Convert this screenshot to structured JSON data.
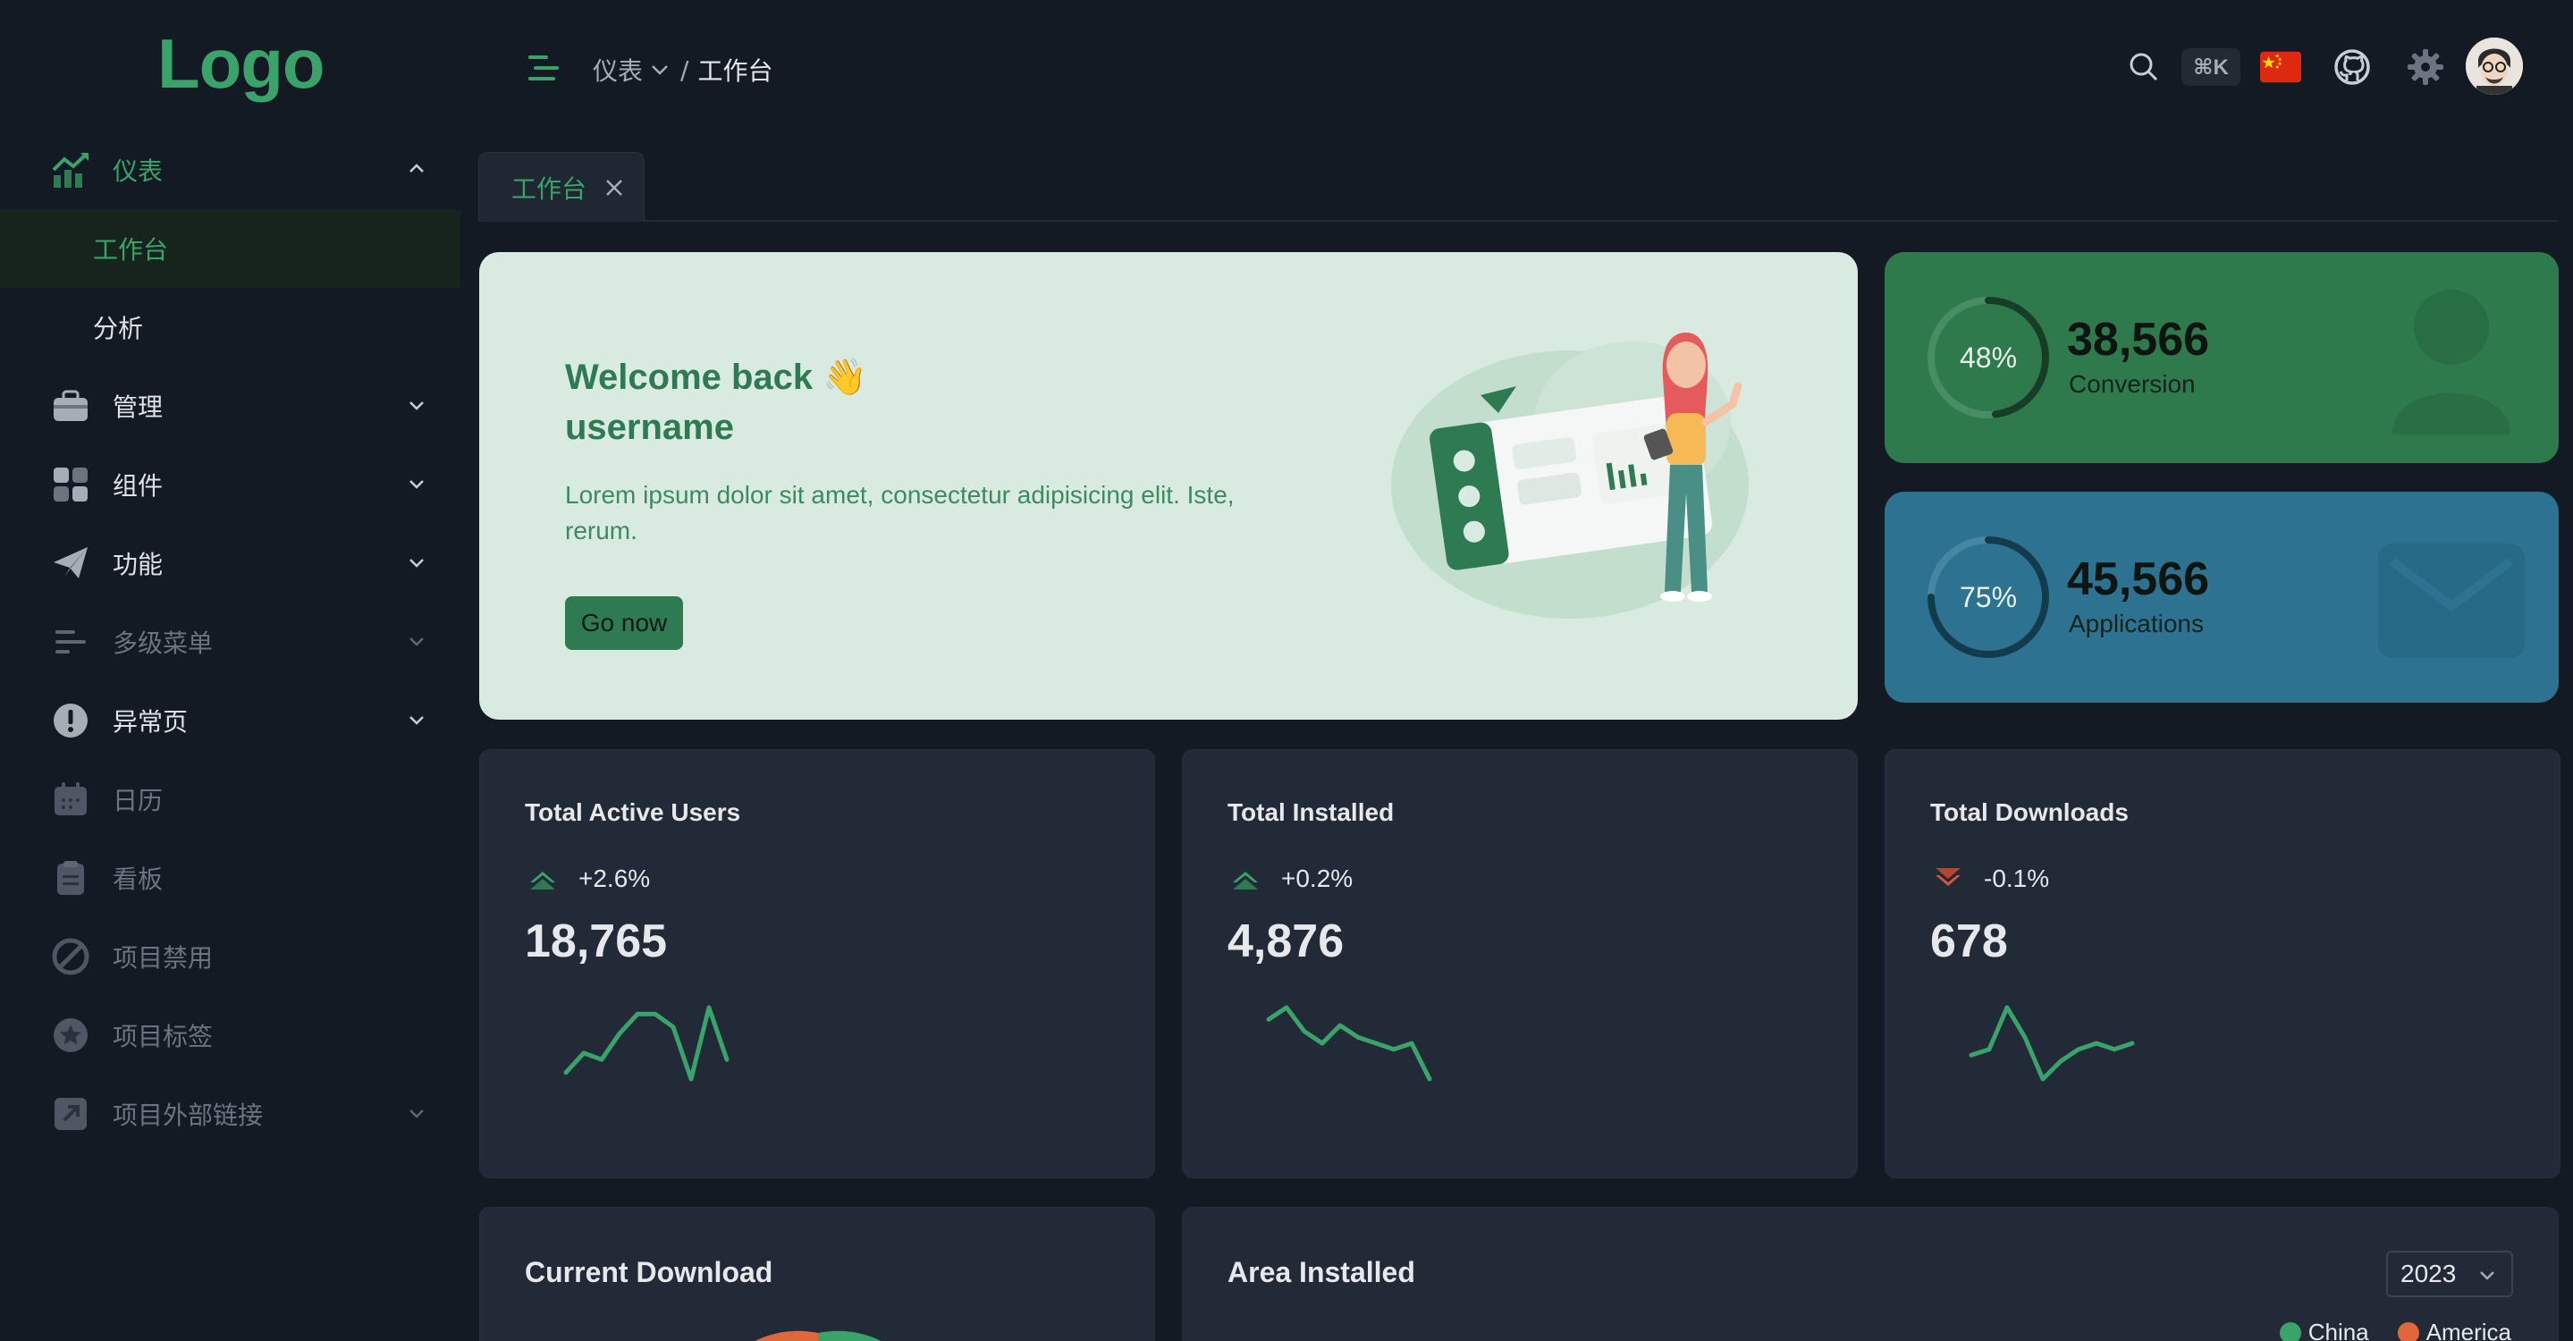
{
  "logo": "Logo",
  "colors": {
    "accent": "#3aa36a",
    "widget_green": "#2f7a4c",
    "widget_blue": "#2d7391",
    "down": "#d9553f",
    "china": "#3aa36a",
    "america": "#e0663c"
  },
  "sidebar": {
    "items": [
      {
        "label": "仪表",
        "icon": "chart-icon",
        "expanded": true
      },
      {
        "label": "管理",
        "icon": "briefcase-icon"
      },
      {
        "label": "组件",
        "icon": "grid-icon"
      },
      {
        "label": "功能",
        "icon": "send-icon"
      },
      {
        "label": "多级菜单",
        "icon": "menu-lines-icon"
      },
      {
        "label": "异常页",
        "icon": "alert-icon"
      },
      {
        "label": "日历",
        "icon": "calendar-icon"
      },
      {
        "label": "看板",
        "icon": "clipboard-icon"
      },
      {
        "label": "项目禁用",
        "icon": "disabled-icon"
      },
      {
        "label": "项目标签",
        "icon": "star-icon"
      },
      {
        "label": "项目外部链接",
        "icon": "external-link-icon"
      }
    ],
    "sub_items": [
      "工作台",
      "分析"
    ]
  },
  "header": {
    "breadcrumb": {
      "parent": "仪表",
      "separator": "/",
      "current": "工作台"
    },
    "shortcut": "⌘K"
  },
  "tabs": [
    {
      "label": "工作台"
    }
  ],
  "welcome": {
    "title_line1": "Welcome back 👋",
    "title_line2": "username",
    "description": "Lorem ipsum dolor sit amet, consectetur adipisicing elit. Iste, rerum.",
    "button": "Go now"
  },
  "widgets": [
    {
      "percent_label": "48%",
      "percent": 48,
      "value": "38,566",
      "label": "Conversion"
    },
    {
      "percent_label": "75%",
      "percent": 75,
      "value": "45,566",
      "label": "Applications"
    }
  ],
  "metrics": [
    {
      "title": "Total Active Users",
      "change": "+2.6%",
      "direction": "up",
      "value": "18,765",
      "spark": [
        3,
        6,
        5,
        9,
        12,
        12,
        10,
        2,
        13,
        5
      ]
    },
    {
      "title": "Total Installed",
      "change": "+0.2%",
      "direction": "up",
      "value": "4,876",
      "spark": [
        10,
        12,
        8,
        6,
        9,
        7,
        6,
        5,
        6,
        0
      ]
    },
    {
      "title": "Total Downloads",
      "change": "-0.1%",
      "direction": "down",
      "value": "678",
      "spark": [
        4,
        5,
        12,
        7,
        0,
        3,
        5,
        6,
        5,
        6
      ]
    }
  ],
  "bottom": {
    "current_download": {
      "title": "Current Download"
    },
    "area_installed": {
      "title": "Area Installed",
      "year": "2023",
      "legend": [
        "China",
        "America"
      ]
    }
  }
}
